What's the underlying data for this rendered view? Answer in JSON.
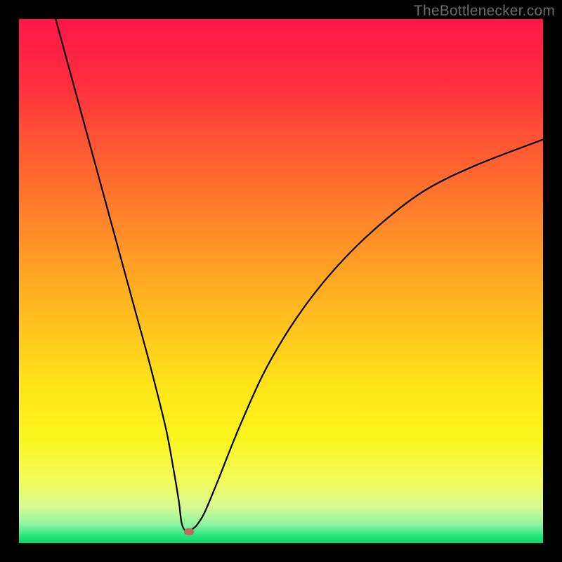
{
  "watermark": "TheBottlenecker.com",
  "colors": {
    "frame": "#000000",
    "gradient_stops": [
      {
        "offset": 0.0,
        "color": "#ff1648"
      },
      {
        "offset": 0.12,
        "color": "#ff2e3f"
      },
      {
        "offset": 0.25,
        "color": "#ff5a33"
      },
      {
        "offset": 0.4,
        "color": "#ff8a29"
      },
      {
        "offset": 0.55,
        "color": "#ffb81f"
      },
      {
        "offset": 0.7,
        "color": "#ffe41a"
      },
      {
        "offset": 0.8,
        "color": "#fbf51c"
      },
      {
        "offset": 0.88,
        "color": "#f3fa5a"
      },
      {
        "offset": 0.93,
        "color": "#d9fa90"
      },
      {
        "offset": 0.965,
        "color": "#8cf3a0"
      },
      {
        "offset": 0.985,
        "color": "#27e77b"
      },
      {
        "offset": 1.0,
        "color": "#0ed868"
      }
    ],
    "curve": "#000000",
    "marker": "#c06a5a"
  },
  "chart_data": {
    "type": "line",
    "title": "",
    "xlabel": "",
    "ylabel": "",
    "xlim": [
      0,
      100
    ],
    "ylim": [
      0,
      100
    ],
    "grid": false,
    "legend": false,
    "series": [
      {
        "name": "bottleneck-curve",
        "x": [
          7.0,
          10.0,
          13.0,
          16.0,
          19.0,
          22.0,
          25.0,
          28.0,
          29.5,
          30.5,
          31.0,
          31.6,
          32.3,
          33.0,
          34.0,
          35.5,
          38.0,
          42.0,
          47.0,
          53.0,
          60.0,
          68.0,
          77.0,
          87.0,
          100.0
        ],
        "y": [
          100.0,
          89.0,
          78.0,
          67.0,
          56.0,
          45.0,
          34.0,
          22.0,
          14.0,
          8.0,
          4.0,
          2.5,
          2.4,
          2.6,
          3.5,
          6.0,
          12.0,
          22.0,
          33.0,
          43.0,
          52.0,
          60.0,
          67.0,
          72.0,
          77.0
        ]
      }
    ],
    "marker": {
      "x": 32.5,
      "y": 2.2
    }
  }
}
